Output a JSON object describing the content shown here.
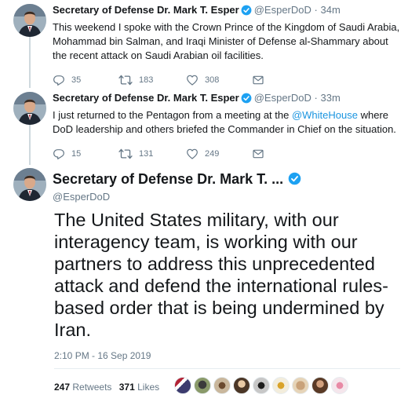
{
  "tweets": [
    {
      "name": "Secretary of Defense Dr. Mark T. Esper",
      "handle": "@EsperDoD",
      "sep": "·",
      "time": "34m",
      "text": "This weekend I spoke with the Crown Prince of the Kingdom of Saudi Arabia, Mohammad bin Salman, and Iraqi Minister of Defense al-Shammary about the recent attack on Saudi Arabian oil facilities.",
      "replies": "35",
      "retweets": "183",
      "likes": "308"
    },
    {
      "name": "Secretary of Defense Dr. Mark T. Esper",
      "handle": "@EsperDoD",
      "sep": "·",
      "time": "33m",
      "text_before": "I just returned to the Pentagon from a meeting at the ",
      "mention": "@WhiteHouse",
      "text_after": " where DoD leadership and others briefed the Commander in Chief on the situation.",
      "replies": "15",
      "retweets": "131",
      "likes": "249"
    }
  ],
  "main_tweet": {
    "name": "Secretary of Defense Dr. Mark T. ...",
    "handle": "@EsperDoD",
    "text": "The United States military, with our interagency team, is working with our partners to address this unprecedented attack and defend the international rules-based order that is being undermined by Iran.",
    "timestamp": "2:10 PM - 16 Sep 2019",
    "retweets_count": "247",
    "retweets_label": "Retweets",
    "likes_count": "371",
    "likes_label": "Likes"
  },
  "colors": {
    "link": "#1b95e0",
    "verified": "#1da1f2",
    "muted": "#657786"
  },
  "icons": [
    "reply-icon",
    "retweet-icon",
    "like-icon",
    "direct-message-icon",
    "verified-badge-icon"
  ]
}
